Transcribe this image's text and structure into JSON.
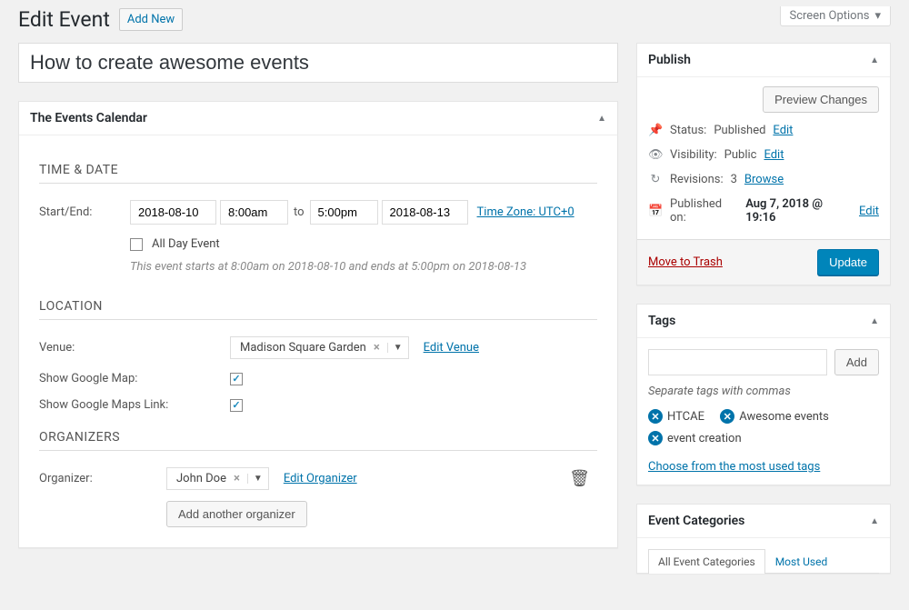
{
  "header": {
    "page_title": "Edit Event",
    "add_new": "Add New",
    "screen_options": "Screen Options"
  },
  "event_title": "How to create awesome events",
  "events_box": {
    "title": "The Events Calendar",
    "time_date_heading": "TIME & DATE",
    "start_end_label": "Start/End:",
    "start_date": "2018-08-10",
    "start_time": "8:00am",
    "to": "to",
    "end_time": "5:00pm",
    "end_date": "2018-08-13",
    "timezone": "Time Zone: UTC+0",
    "all_day": "All Day Event",
    "summary": "This event starts at 8:00am on 2018-08-10 and ends at 5:00pm on 2018-08-13",
    "location_heading": "LOCATION",
    "venue_label": "Venue:",
    "venue_value": "Madison Square Garden",
    "edit_venue": "Edit Venue",
    "show_map_label": "Show Google Map:",
    "show_link_label": "Show Google Maps Link:",
    "organizers_heading": "ORGANIZERS",
    "organizer_label": "Organizer:",
    "organizer_value": "John Doe",
    "edit_organizer": "Edit Organizer",
    "add_organizer": "Add another organizer"
  },
  "publish": {
    "title": "Publish",
    "preview": "Preview Changes",
    "status_label": "Status:",
    "status_value": "Published",
    "visibility_label": "Visibility:",
    "visibility_value": "Public",
    "revisions_label": "Revisions:",
    "revisions_value": "3",
    "browse": "Browse",
    "published_on_label": "Published on:",
    "published_on_value": "Aug 7, 2018 @ 19:16",
    "edit": "Edit",
    "trash": "Move to Trash",
    "update": "Update"
  },
  "tags": {
    "title": "Tags",
    "add": "Add",
    "hint": "Separate tags with commas",
    "items": [
      "HTCAE",
      "Awesome events",
      "event creation"
    ],
    "choose": "Choose from the most used tags"
  },
  "categories": {
    "title": "Event Categories",
    "tab_all": "All Event Categories",
    "tab_most": "Most Used"
  }
}
